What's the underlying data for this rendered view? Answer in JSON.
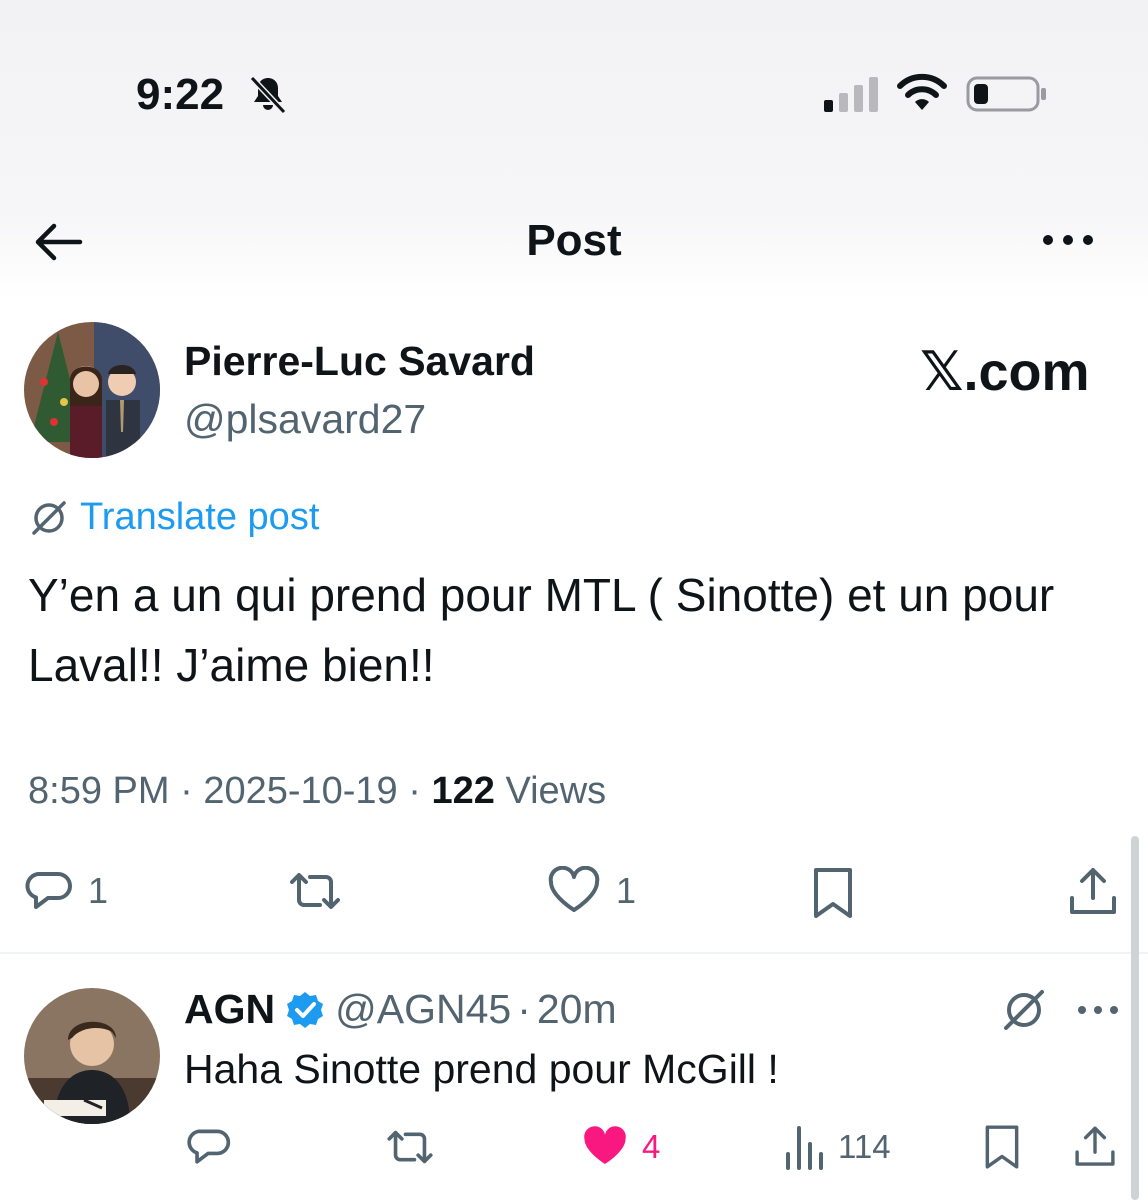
{
  "status_bar": {
    "time": "9:22"
  },
  "nav": {
    "title": "Post"
  },
  "post": {
    "author_name": "Pierre-Luc Savard",
    "author_handle": "@plsavard27",
    "watermark": "𝕏.com",
    "translate_label": "Translate post",
    "text": "Y’en a un qui prend pour MTL ( Sinotte) et un pour Laval!! J’aime bien!!",
    "time": "8:59 PM",
    "date": "2025-10-19",
    "separator": "·",
    "views_count": "122",
    "views_label": "Views",
    "reply_count": "1",
    "like_count": "1"
  },
  "reply": {
    "author_name": "AGN",
    "author_handle": "@AGN45",
    "age": "20m",
    "text": "Haha Sinotte prend pour McGill !",
    "like_count": "4",
    "views_count": "114"
  },
  "colors": {
    "text": "#0f1419",
    "secondary": "#536471",
    "link": "#1d9bf0",
    "like_active": "#f91880",
    "divider": "#eff3f4"
  },
  "icons": [
    "bell-slash-icon",
    "signal-icon",
    "wifi-icon",
    "battery-icon",
    "back-arrow-icon",
    "more-icon",
    "translate-icon",
    "reply-icon",
    "repost-icon",
    "like-icon",
    "bookmark-icon",
    "share-icon",
    "verified-badge-icon",
    "views-icon"
  ]
}
